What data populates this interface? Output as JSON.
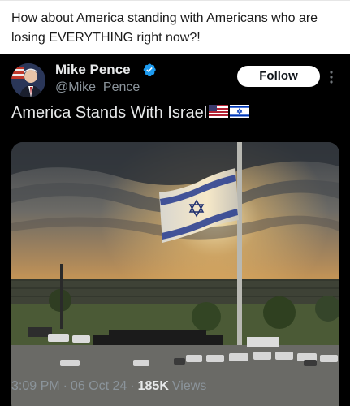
{
  "quote": {
    "text": "How about America standing with Americans who are losing EVERYTHING right now?!"
  },
  "tweet": {
    "author_name": "Mike Pence",
    "author_handle": "@Mike_Pence",
    "follow_label": "Follow",
    "text": "America Stands With Israel",
    "flags": [
      "us-flag-icon",
      "israel-flag-icon"
    ],
    "time": "3:09 PM",
    "separator": "·",
    "date": "06 Oct 24",
    "views_count": "185K",
    "views_label": "Views"
  },
  "colors": {
    "tweet_bg": "#000000",
    "verified_blue": "#1d9bf0",
    "muted_text": "#8b949b"
  }
}
